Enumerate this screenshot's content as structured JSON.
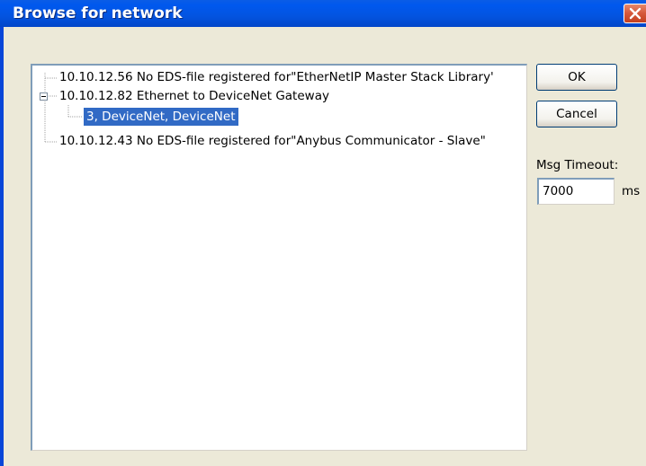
{
  "window": {
    "title": "Browse for network"
  },
  "tree": {
    "items": [
      {
        "label": "10.10.12.56 No EDS-file registered for\"EtherNetIP Master Stack Library'"
      },
      {
        "label": "10.10.12.82 Ethernet to DeviceNet Gateway"
      },
      {
        "label": "3, DeviceNet, DeviceNet"
      },
      {
        "label": "10.10.12.43 No EDS-file registered for\"Anybus Communicator - Slave\""
      }
    ]
  },
  "buttons": {
    "ok_label": "OK",
    "cancel_label": "Cancel"
  },
  "timeout": {
    "label": "Msg Timeout:",
    "value": "7000",
    "unit": "ms"
  },
  "colors": {
    "selection": "#316ac5",
    "titlebar": "#0058ee",
    "dialog_bg": "#ece9d8"
  }
}
